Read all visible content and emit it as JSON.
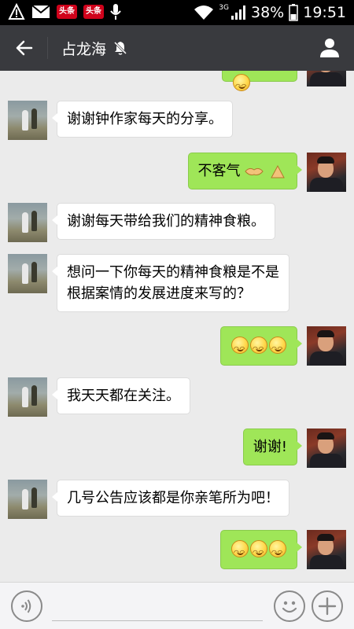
{
  "status_bar": {
    "toutiao_1": "头条",
    "toutiao_2": "头条",
    "network": "3G",
    "battery": "38%",
    "time": "19:51"
  },
  "header": {
    "title": "占龙海"
  },
  "messages": [
    {
      "from": "me",
      "text": ""
    },
    {
      "from": "friend",
      "text": "谢谢钟作家每天的分享。"
    },
    {
      "from": "me",
      "text": "不客气"
    },
    {
      "from": "friend",
      "text": "谢谢每天带给我们的精神食粮。"
    },
    {
      "from": "friend",
      "line1": "想问一下你每天的精神食粮是不是",
      "line2": "根据案情的发展进度来写的？"
    },
    {
      "from": "me",
      "text": ""
    },
    {
      "from": "friend",
      "text": "我天天都在关注。"
    },
    {
      "from": "me",
      "text": "谢谢!"
    },
    {
      "from": "friend",
      "text": "几号公告应该都是你亲笔所为吧！"
    },
    {
      "from": "me",
      "text": ""
    }
  ],
  "colors": {
    "navbar": "#393a3e",
    "my_bubble": "#9fe658",
    "friend_bubble": "#ffffff",
    "chat_bg": "#ebebeb"
  }
}
